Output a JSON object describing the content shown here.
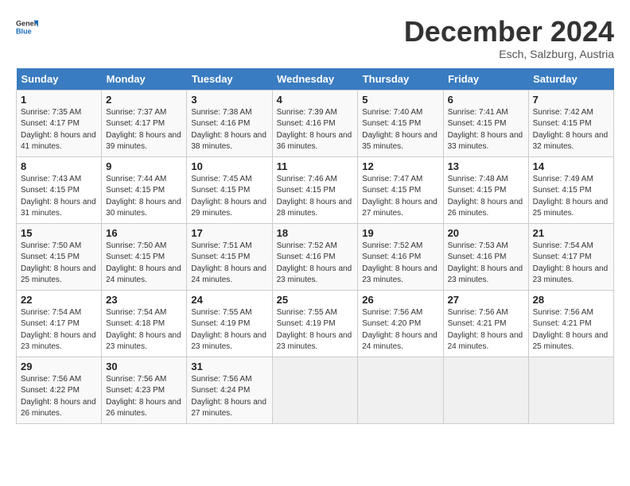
{
  "logo": {
    "text1": "General",
    "text2": "Blue"
  },
  "title": "December 2024",
  "subtitle": "Esch, Salzburg, Austria",
  "headers": [
    "Sunday",
    "Monday",
    "Tuesday",
    "Wednesday",
    "Thursday",
    "Friday",
    "Saturday"
  ],
  "weeks": [
    [
      {
        "num": "1",
        "sunrise": "7:35 AM",
        "sunset": "4:17 PM",
        "daylight": "8 hours and 41 minutes."
      },
      {
        "num": "2",
        "sunrise": "7:37 AM",
        "sunset": "4:17 PM",
        "daylight": "8 hours and 39 minutes."
      },
      {
        "num": "3",
        "sunrise": "7:38 AM",
        "sunset": "4:16 PM",
        "daylight": "8 hours and 38 minutes."
      },
      {
        "num": "4",
        "sunrise": "7:39 AM",
        "sunset": "4:16 PM",
        "daylight": "8 hours and 36 minutes."
      },
      {
        "num": "5",
        "sunrise": "7:40 AM",
        "sunset": "4:15 PM",
        "daylight": "8 hours and 35 minutes."
      },
      {
        "num": "6",
        "sunrise": "7:41 AM",
        "sunset": "4:15 PM",
        "daylight": "8 hours and 33 minutes."
      },
      {
        "num": "7",
        "sunrise": "7:42 AM",
        "sunset": "4:15 PM",
        "daylight": "8 hours and 32 minutes."
      }
    ],
    [
      {
        "num": "8",
        "sunrise": "7:43 AM",
        "sunset": "4:15 PM",
        "daylight": "8 hours and 31 minutes."
      },
      {
        "num": "9",
        "sunrise": "7:44 AM",
        "sunset": "4:15 PM",
        "daylight": "8 hours and 30 minutes."
      },
      {
        "num": "10",
        "sunrise": "7:45 AM",
        "sunset": "4:15 PM",
        "daylight": "8 hours and 29 minutes."
      },
      {
        "num": "11",
        "sunrise": "7:46 AM",
        "sunset": "4:15 PM",
        "daylight": "8 hours and 28 minutes."
      },
      {
        "num": "12",
        "sunrise": "7:47 AM",
        "sunset": "4:15 PM",
        "daylight": "8 hours and 27 minutes."
      },
      {
        "num": "13",
        "sunrise": "7:48 AM",
        "sunset": "4:15 PM",
        "daylight": "8 hours and 26 minutes."
      },
      {
        "num": "14",
        "sunrise": "7:49 AM",
        "sunset": "4:15 PM",
        "daylight": "8 hours and 25 minutes."
      }
    ],
    [
      {
        "num": "15",
        "sunrise": "7:50 AM",
        "sunset": "4:15 PM",
        "daylight": "8 hours and 25 minutes."
      },
      {
        "num": "16",
        "sunrise": "7:50 AM",
        "sunset": "4:15 PM",
        "daylight": "8 hours and 24 minutes."
      },
      {
        "num": "17",
        "sunrise": "7:51 AM",
        "sunset": "4:15 PM",
        "daylight": "8 hours and 24 minutes."
      },
      {
        "num": "18",
        "sunrise": "7:52 AM",
        "sunset": "4:16 PM",
        "daylight": "8 hours and 23 minutes."
      },
      {
        "num": "19",
        "sunrise": "7:52 AM",
        "sunset": "4:16 PM",
        "daylight": "8 hours and 23 minutes."
      },
      {
        "num": "20",
        "sunrise": "7:53 AM",
        "sunset": "4:16 PM",
        "daylight": "8 hours and 23 minutes."
      },
      {
        "num": "21",
        "sunrise": "7:54 AM",
        "sunset": "4:17 PM",
        "daylight": "8 hours and 23 minutes."
      }
    ],
    [
      {
        "num": "22",
        "sunrise": "7:54 AM",
        "sunset": "4:17 PM",
        "daylight": "8 hours and 23 minutes."
      },
      {
        "num": "23",
        "sunrise": "7:54 AM",
        "sunset": "4:18 PM",
        "daylight": "8 hours and 23 minutes."
      },
      {
        "num": "24",
        "sunrise": "7:55 AM",
        "sunset": "4:19 PM",
        "daylight": "8 hours and 23 minutes."
      },
      {
        "num": "25",
        "sunrise": "7:55 AM",
        "sunset": "4:19 PM",
        "daylight": "8 hours and 23 minutes."
      },
      {
        "num": "26",
        "sunrise": "7:56 AM",
        "sunset": "4:20 PM",
        "daylight": "8 hours and 24 minutes."
      },
      {
        "num": "27",
        "sunrise": "7:56 AM",
        "sunset": "4:21 PM",
        "daylight": "8 hours and 24 minutes."
      },
      {
        "num": "28",
        "sunrise": "7:56 AM",
        "sunset": "4:21 PM",
        "daylight": "8 hours and 25 minutes."
      }
    ],
    [
      {
        "num": "29",
        "sunrise": "7:56 AM",
        "sunset": "4:22 PM",
        "daylight": "8 hours and 26 minutes."
      },
      {
        "num": "30",
        "sunrise": "7:56 AM",
        "sunset": "4:23 PM",
        "daylight": "8 hours and 26 minutes."
      },
      {
        "num": "31",
        "sunrise": "7:56 AM",
        "sunset": "4:24 PM",
        "daylight": "8 hours and 27 minutes."
      },
      null,
      null,
      null,
      null
    ]
  ],
  "labels": {
    "sunrise": "Sunrise:",
    "sunset": "Sunset:",
    "daylight": "Daylight:"
  }
}
